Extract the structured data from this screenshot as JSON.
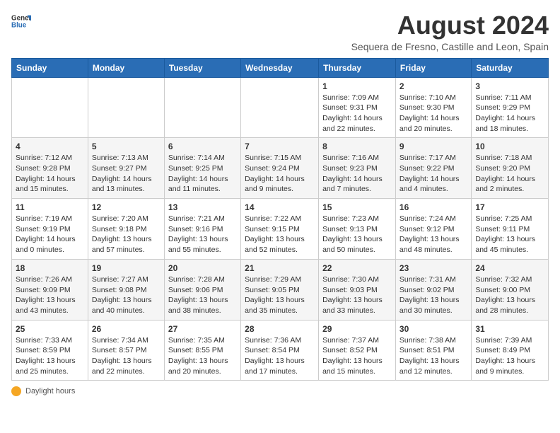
{
  "header": {
    "logo_general": "General",
    "logo_blue": "Blue",
    "title": "August 2024",
    "subtitle": "Sequera de Fresno, Castille and Leon, Spain"
  },
  "calendar": {
    "days_of_week": [
      "Sunday",
      "Monday",
      "Tuesday",
      "Wednesday",
      "Thursday",
      "Friday",
      "Saturday"
    ],
    "weeks": [
      [
        {
          "date": "",
          "info": ""
        },
        {
          "date": "",
          "info": ""
        },
        {
          "date": "",
          "info": ""
        },
        {
          "date": "",
          "info": ""
        },
        {
          "date": "1",
          "info": "Sunrise: 7:09 AM\nSunset: 9:31 PM\nDaylight: 14 hours and 22 minutes."
        },
        {
          "date": "2",
          "info": "Sunrise: 7:10 AM\nSunset: 9:30 PM\nDaylight: 14 hours and 20 minutes."
        },
        {
          "date": "3",
          "info": "Sunrise: 7:11 AM\nSunset: 9:29 PM\nDaylight: 14 hours and 18 minutes."
        }
      ],
      [
        {
          "date": "4",
          "info": "Sunrise: 7:12 AM\nSunset: 9:28 PM\nDaylight: 14 hours and 15 minutes."
        },
        {
          "date": "5",
          "info": "Sunrise: 7:13 AM\nSunset: 9:27 PM\nDaylight: 14 hours and 13 minutes."
        },
        {
          "date": "6",
          "info": "Sunrise: 7:14 AM\nSunset: 9:25 PM\nDaylight: 14 hours and 11 minutes."
        },
        {
          "date": "7",
          "info": "Sunrise: 7:15 AM\nSunset: 9:24 PM\nDaylight: 14 hours and 9 minutes."
        },
        {
          "date": "8",
          "info": "Sunrise: 7:16 AM\nSunset: 9:23 PM\nDaylight: 14 hours and 7 minutes."
        },
        {
          "date": "9",
          "info": "Sunrise: 7:17 AM\nSunset: 9:22 PM\nDaylight: 14 hours and 4 minutes."
        },
        {
          "date": "10",
          "info": "Sunrise: 7:18 AM\nSunset: 9:20 PM\nDaylight: 14 hours and 2 minutes."
        }
      ],
      [
        {
          "date": "11",
          "info": "Sunrise: 7:19 AM\nSunset: 9:19 PM\nDaylight: 14 hours and 0 minutes."
        },
        {
          "date": "12",
          "info": "Sunrise: 7:20 AM\nSunset: 9:18 PM\nDaylight: 13 hours and 57 minutes."
        },
        {
          "date": "13",
          "info": "Sunrise: 7:21 AM\nSunset: 9:16 PM\nDaylight: 13 hours and 55 minutes."
        },
        {
          "date": "14",
          "info": "Sunrise: 7:22 AM\nSunset: 9:15 PM\nDaylight: 13 hours and 52 minutes."
        },
        {
          "date": "15",
          "info": "Sunrise: 7:23 AM\nSunset: 9:13 PM\nDaylight: 13 hours and 50 minutes."
        },
        {
          "date": "16",
          "info": "Sunrise: 7:24 AM\nSunset: 9:12 PM\nDaylight: 13 hours and 48 minutes."
        },
        {
          "date": "17",
          "info": "Sunrise: 7:25 AM\nSunset: 9:11 PM\nDaylight: 13 hours and 45 minutes."
        }
      ],
      [
        {
          "date": "18",
          "info": "Sunrise: 7:26 AM\nSunset: 9:09 PM\nDaylight: 13 hours and 43 minutes."
        },
        {
          "date": "19",
          "info": "Sunrise: 7:27 AM\nSunset: 9:08 PM\nDaylight: 13 hours and 40 minutes."
        },
        {
          "date": "20",
          "info": "Sunrise: 7:28 AM\nSunset: 9:06 PM\nDaylight: 13 hours and 38 minutes."
        },
        {
          "date": "21",
          "info": "Sunrise: 7:29 AM\nSunset: 9:05 PM\nDaylight: 13 hours and 35 minutes."
        },
        {
          "date": "22",
          "info": "Sunrise: 7:30 AM\nSunset: 9:03 PM\nDaylight: 13 hours and 33 minutes."
        },
        {
          "date": "23",
          "info": "Sunrise: 7:31 AM\nSunset: 9:02 PM\nDaylight: 13 hours and 30 minutes."
        },
        {
          "date": "24",
          "info": "Sunrise: 7:32 AM\nSunset: 9:00 PM\nDaylight: 13 hours and 28 minutes."
        }
      ],
      [
        {
          "date": "25",
          "info": "Sunrise: 7:33 AM\nSunset: 8:59 PM\nDaylight: 13 hours and 25 minutes."
        },
        {
          "date": "26",
          "info": "Sunrise: 7:34 AM\nSunset: 8:57 PM\nDaylight: 13 hours and 22 minutes."
        },
        {
          "date": "27",
          "info": "Sunrise: 7:35 AM\nSunset: 8:55 PM\nDaylight: 13 hours and 20 minutes."
        },
        {
          "date": "28",
          "info": "Sunrise: 7:36 AM\nSunset: 8:54 PM\nDaylight: 13 hours and 17 minutes."
        },
        {
          "date": "29",
          "info": "Sunrise: 7:37 AM\nSunset: 8:52 PM\nDaylight: 13 hours and 15 minutes."
        },
        {
          "date": "30",
          "info": "Sunrise: 7:38 AM\nSunset: 8:51 PM\nDaylight: 13 hours and 12 minutes."
        },
        {
          "date": "31",
          "info": "Sunrise: 7:39 AM\nSunset: 8:49 PM\nDaylight: 13 hours and 9 minutes."
        }
      ]
    ]
  },
  "footer": {
    "daylight_label": "Daylight hours"
  }
}
